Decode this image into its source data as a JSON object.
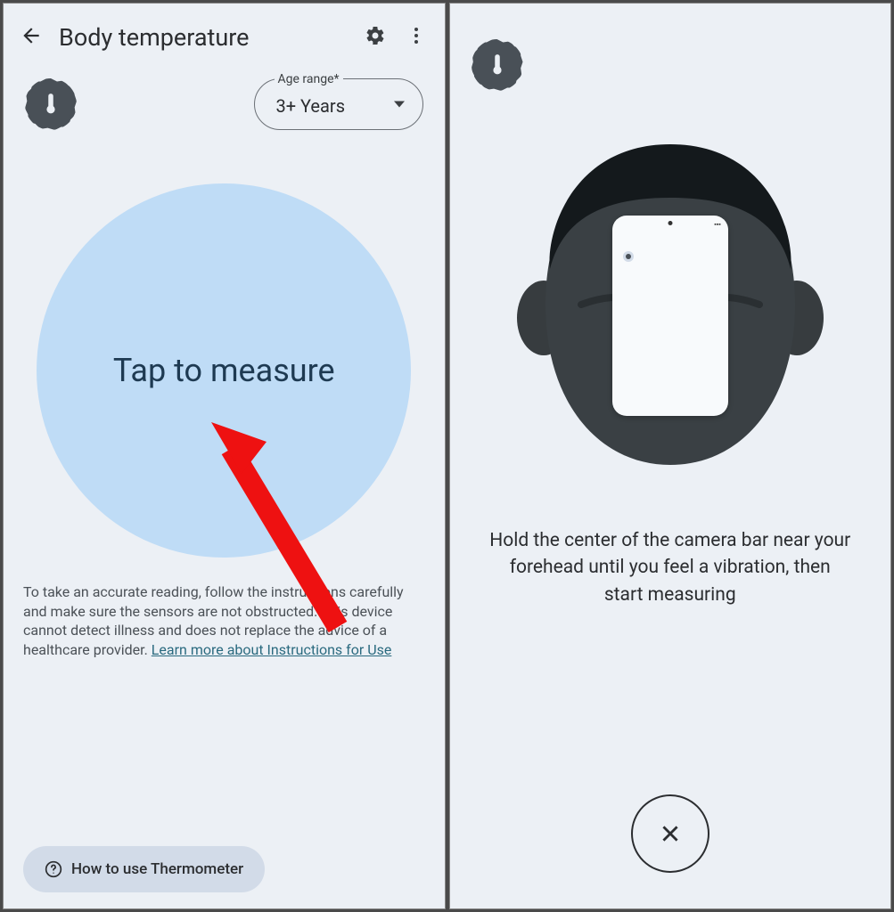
{
  "panel1": {
    "title": "Body temperature",
    "age_label": "Age range*",
    "age_value": "3+ Years",
    "measure_cta": "Tap to measure",
    "disclaimer_text": "To take an accurate reading, follow the instructions carefully and make sure the sensors are not obstructed. This device cannot detect illness and does not replace the advice of a healthcare provider. ",
    "disclaimer_link": "Learn more about Instructions for Use",
    "howto_label": "How to use Thermometer"
  },
  "panel2": {
    "instruction": "Hold the center of the camera bar near your forehead until you feel a vibration, then start measuring"
  }
}
